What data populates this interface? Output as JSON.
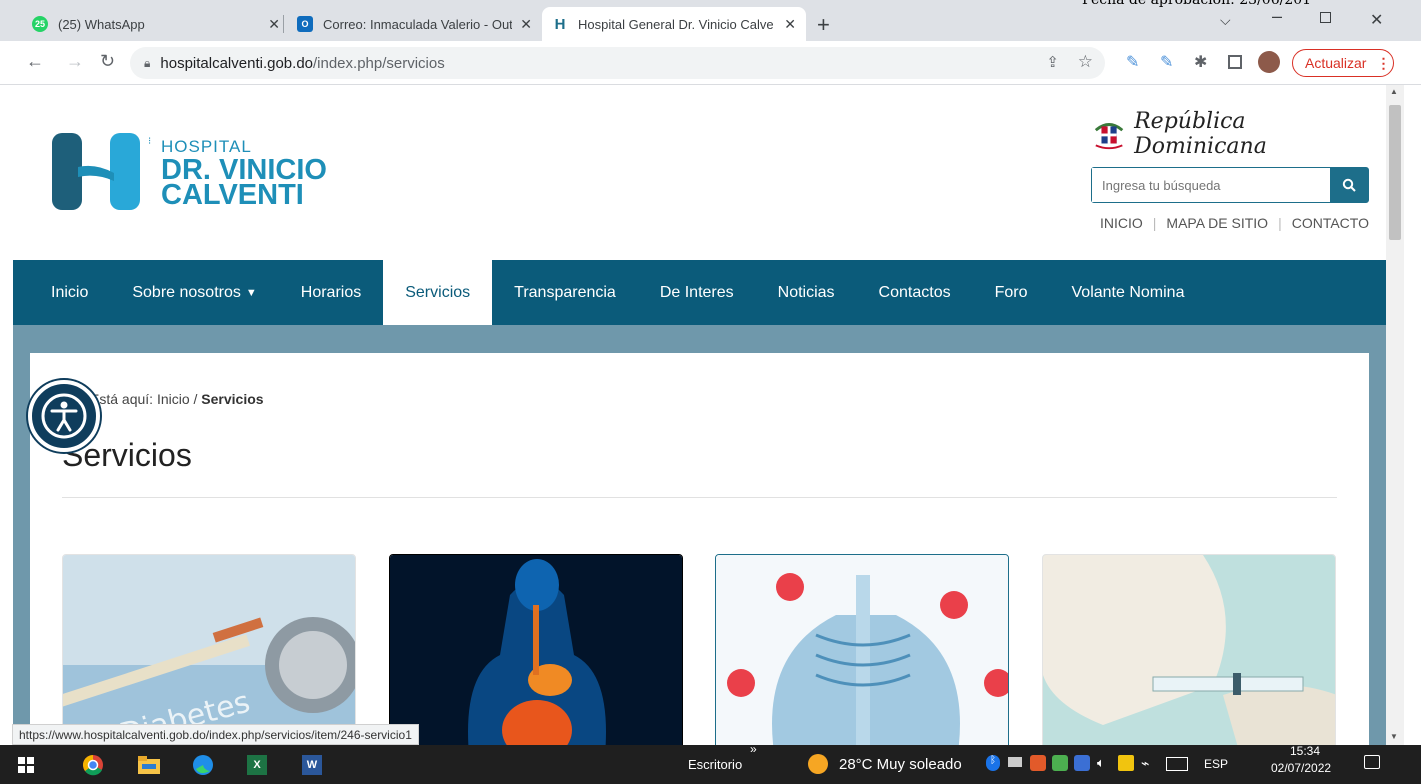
{
  "tabs": [
    {
      "title": "(25) WhatsApp",
      "badge": "25",
      "color": "#25d366"
    },
    {
      "title": "Correo: Inmaculada Valerio - Out",
      "badge": "O",
      "color": "#0f6cbd"
    },
    {
      "title": "Hospital General Dr. Vinicio Calve",
      "badge": "H",
      "color": "#1d6e8a"
    }
  ],
  "overlay_text": "Fecha de aprobación: 23/06/201",
  "address": {
    "host": "hospitalcalventi.gob.do",
    "path": "/index.php/servicios"
  },
  "update_label": "Actualizar",
  "logo": {
    "line1": "HOSPITAL",
    "line2": "DR. VINICIO",
    "line3": "CALVENTI"
  },
  "rd_label": "República Dominicana",
  "search": {
    "placeholder": "Ingresa tu búsqueda"
  },
  "toplinks": [
    "INICIO",
    "MAPA DE SITIO",
    "CONTACTO"
  ],
  "nav": [
    "Inicio",
    "Sobre nosotros",
    "Horarios",
    "Servicios",
    "Transparencia",
    "De Interes",
    "Noticias",
    "Contactos",
    "Foro",
    "Volante Nomina"
  ],
  "breadcrumb": {
    "prefix": "Está aquí:",
    "home": "Inicio",
    "sep": "/",
    "current": "Servicios"
  },
  "page_title": "Servicios",
  "status_url": "https://www.hospitalcalventi.gob.do/index.php/servicios/item/246-servicio1",
  "taskbar": {
    "desktop": "Escritorio",
    "weather": "28°C  Muy soleado",
    "lang": "ESP",
    "time": "15:34",
    "date": "02/07/2022"
  },
  "colors": {
    "nav": "#0b5b7a",
    "band": "#6f98ab",
    "accent": "#1d6e8a"
  }
}
